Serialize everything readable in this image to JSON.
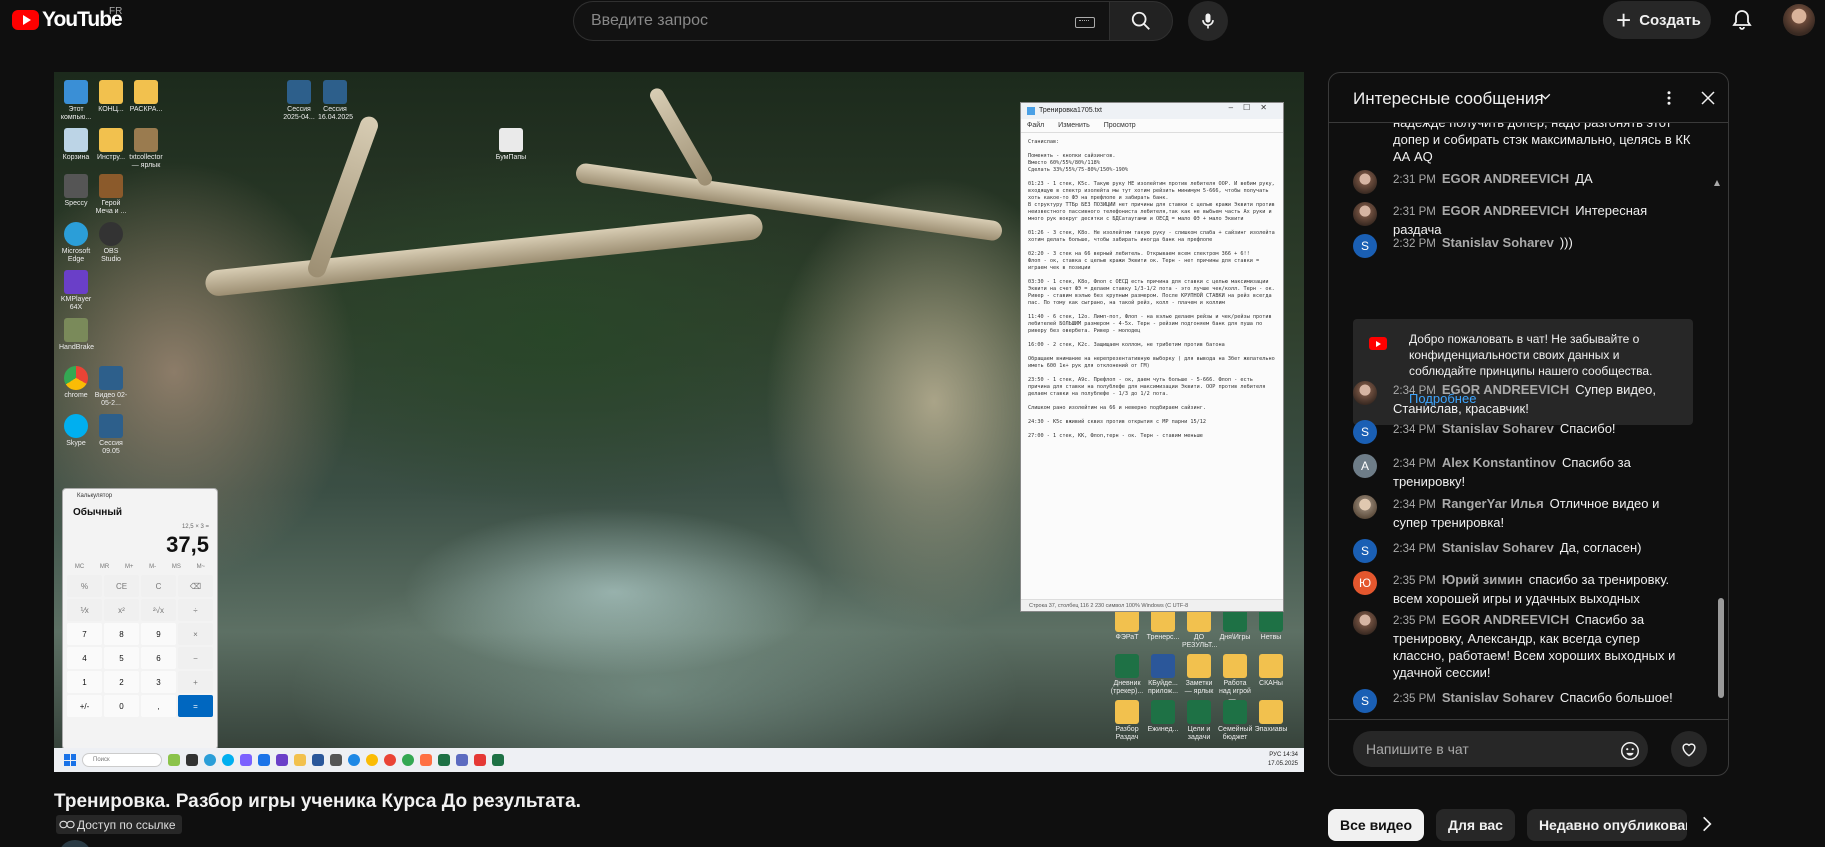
{
  "header": {
    "logo_text": "YouTube",
    "country_code": "FR",
    "search_placeholder": "Введите запрос",
    "create_label": "Создать"
  },
  "player": {
    "desktop_icons": [
      "Этот компью...",
      "КОНЦ...",
      "РАСКРА...",
      "Корзина",
      "Инстру...",
      "txtcollector — ярлык",
      "Speccy",
      "Герой Меча и ...",
      "Microsoft Edge",
      "OBS Studio",
      "KMPlayer 64X",
      "HandBrake",
      "chrome",
      "Видео 02-05-2...",
      "Skype",
      "Сессия 09.05",
      "БумПапы",
      "Сессия 2025-04...",
      "Сессия 16.04.2025"
    ],
    "right_icons": [
      "ФЭРаТ",
      "Тренерс...",
      "ДО РЕЗУЛЬТ...",
      "Дня\\Игры",
      "Нетвы",
      "Дневник (трекер)...",
      "КБуйде... прилож...",
      "Заметки — ярлык",
      "Работа над игрой —...",
      "СКАНы",
      "Разбор Раздач",
      "Ежинед...",
      "Цели и задачи",
      "Семейный бюджет",
      "Эпахиавы"
    ],
    "notepad": {
      "title": "Тренировка1705.txt",
      "menu": [
        "Файл",
        "Изменить",
        "Просмотр"
      ],
      "body": "Станислав:\n\nПоменять - кнопки сайзингов.\nВместо 60%/55%/80%/118%\nСделать 33%/55%/75-80%/150%-190%\n\n01:23 - 1 стек, K5c. Такую руку НЕ изолейтим против лебителя ООР. И вебим руку, входящую в спектр изолейта мы тут хотим рейзить минимум 5-666, чтобы получать хоть какое-то ФЭ на префлопе и забирать банк.\nВ структуру ТТБр БЕЗ ПОЗИЦИИ нет причины для ставки с целью кражи Эквити против неизвестного пассивного телефониста лебителя,так как не выбьем часть Ах руки и много рук вокруг десятки с БДСатаутами и ОЕСД = мало ФЭ + мало Эквити\n\n01:26 - 3 стек, K8o. Не изолейтим такую руку - слишком слаба + сайзинг изолейта хотим делать больше, чтобы забирать иногда банк на префлопе\n\n02:20 - 3 стек на 66 верный лебитель. Открываем всем спектром 366 + 6!!\nФлоп - ок, ставка с целью кражи Эквити ок. Терн - нет причины для ставки = играем чек в позиции\n\n03:30 - 1 стек, K8o, Флоп с ОЕСД есть причина для ставки с целью максимизации Эквити на счет ФЭ = делаем ставку 1/3-1/2 пота - это лучше чек/колл. Терн - ок. Ривер - ставим вэлью без крупным размером. После КРУПНОЙ СТАВКИ на рейз всегда пас. По тому как сыграно, на такой рейз, колл - плачем и коллим\n\n11:40 - 6 стек, 12o. Лимп-пот, Флоп - на вэлью делаем рейзы и чек/рейзы против лебителей БОЛЬШИМ размером - 4-5х. Терн - рейзим подгоняем банк для пуша по риверу без овербета. Ривер - молодец\n\n16:00 - 2 стек, K2c. Защищаем коллом, не трибетим против батона\n\nОбращаем внимание на нерепрезентативную выборку ( для вывода на 3бет желательно иметь 600 1к+ рук для отклонений от ГМ)\n\n23:50 - 1 стек, A9c. Префлоп - ок, даем чуть больше - 5-666. Флоп - есть причина для ставки на полублефе для максимизации Эквити. ООР против лебителя делаем ставки на полублефе - 1/3 до 1/2 пота.\n\nСлишком рано изолейтим на 66 и неверно подбираем сайзинг.\n\n24:30 - K5c вживий сквиз против открытия с МР парни 15/12\n\n27:00 - 1 стек, KK, Флоп,терн - ок. Терн - ставим меньше",
      "status": "Строка 37, столбец 116   2 230 символ   100%   Windows (C   UTF-8"
    },
    "calculator": {
      "title": "Калькулятор",
      "mode": "Обычный",
      "expression": "12,5 × 3 =",
      "display": "37,5",
      "memory": [
        "MC",
        "MR",
        "M+",
        "M-",
        "MS",
        "M~"
      ],
      "keys": [
        "%",
        "CE",
        "C",
        "⌫",
        "⅟x",
        "x²",
        "²√x",
        "÷",
        "7",
        "8",
        "9",
        "×",
        "4",
        "5",
        "6",
        "−",
        "1",
        "2",
        "3",
        "+",
        "+/-",
        "0",
        ",",
        "="
      ]
    },
    "taskbar": {
      "search": "Поиск",
      "lang": "РУС",
      "time": "14:34",
      "date": "17.05.2025"
    }
  },
  "video": {
    "title": "Тренировка. Разбор игры ученика Курса До результата.",
    "access": "Доступ по ссылке"
  },
  "chat": {
    "title": "Интересные сообщения",
    "messages": [
      {
        "time": "",
        "author": "",
        "text": "надежде получить допер, надо разгонять этот допер и собирать стэк максимально, целясь в КК АА AQ",
        "avatar": "none"
      },
      {
        "time": "2:31 PM",
        "author": "EGOR ANDREEVICH",
        "text": "ДА",
        "avatar": "photo"
      },
      {
        "time": "2:31 PM",
        "author": "EGOR ANDREEVICH",
        "text": "Интересная раздача",
        "avatar": "photo"
      },
      {
        "time": "2:32 PM",
        "author": "Stanislav Soharev",
        "text": ")))",
        "avatar": "S"
      },
      {
        "time": "2:34 PM",
        "author": "EGOR ANDREEVICH",
        "text": "Супер видео, Станислав, красавчик!",
        "avatar": "photo"
      },
      {
        "time": "2:34 PM",
        "author": "Stanislav Soharev",
        "text": "Спасибо!",
        "avatar": "S"
      },
      {
        "time": "2:34 PM",
        "author": "Alex Konstantinov",
        "text": "Спасибо за тренировку!",
        "avatar": "A"
      },
      {
        "time": "2:34 PM",
        "author": "RangerYar Илья",
        "text": "Отличное видео и супер тренировка!",
        "avatar": "photo2"
      },
      {
        "time": "2:34 PM",
        "author": "Stanislav Soharev",
        "text": "Да, согласен)",
        "avatar": "S"
      },
      {
        "time": "2:35 PM",
        "author": "Юрий зимин",
        "text": "спасибо за тренировку. всем хорошей игры и удачных выходных",
        "avatar": "Ю"
      },
      {
        "time": "2:35 PM",
        "author": "EGOR ANDREEVICH",
        "text": "Спасибо за тренировку, Александр, как всегда супер классно, работаем! Всем хороших выходных и удачной сессии!",
        "avatar": "photo"
      },
      {
        "time": "2:35 PM",
        "author": "Stanislav Soharev",
        "text": "Спасибо большое!",
        "avatar": "S"
      }
    ],
    "welcome_text": "Добро пожаловать в чат! Не забывайте о конфиденциальности своих данных и соблюдайте принципы нашего сообщества.",
    "welcome_link": "Подробнее",
    "input_placeholder": "Напишите в чат"
  },
  "chips": [
    "Все видео",
    "Для вас",
    "Недавно опубликованные"
  ]
}
